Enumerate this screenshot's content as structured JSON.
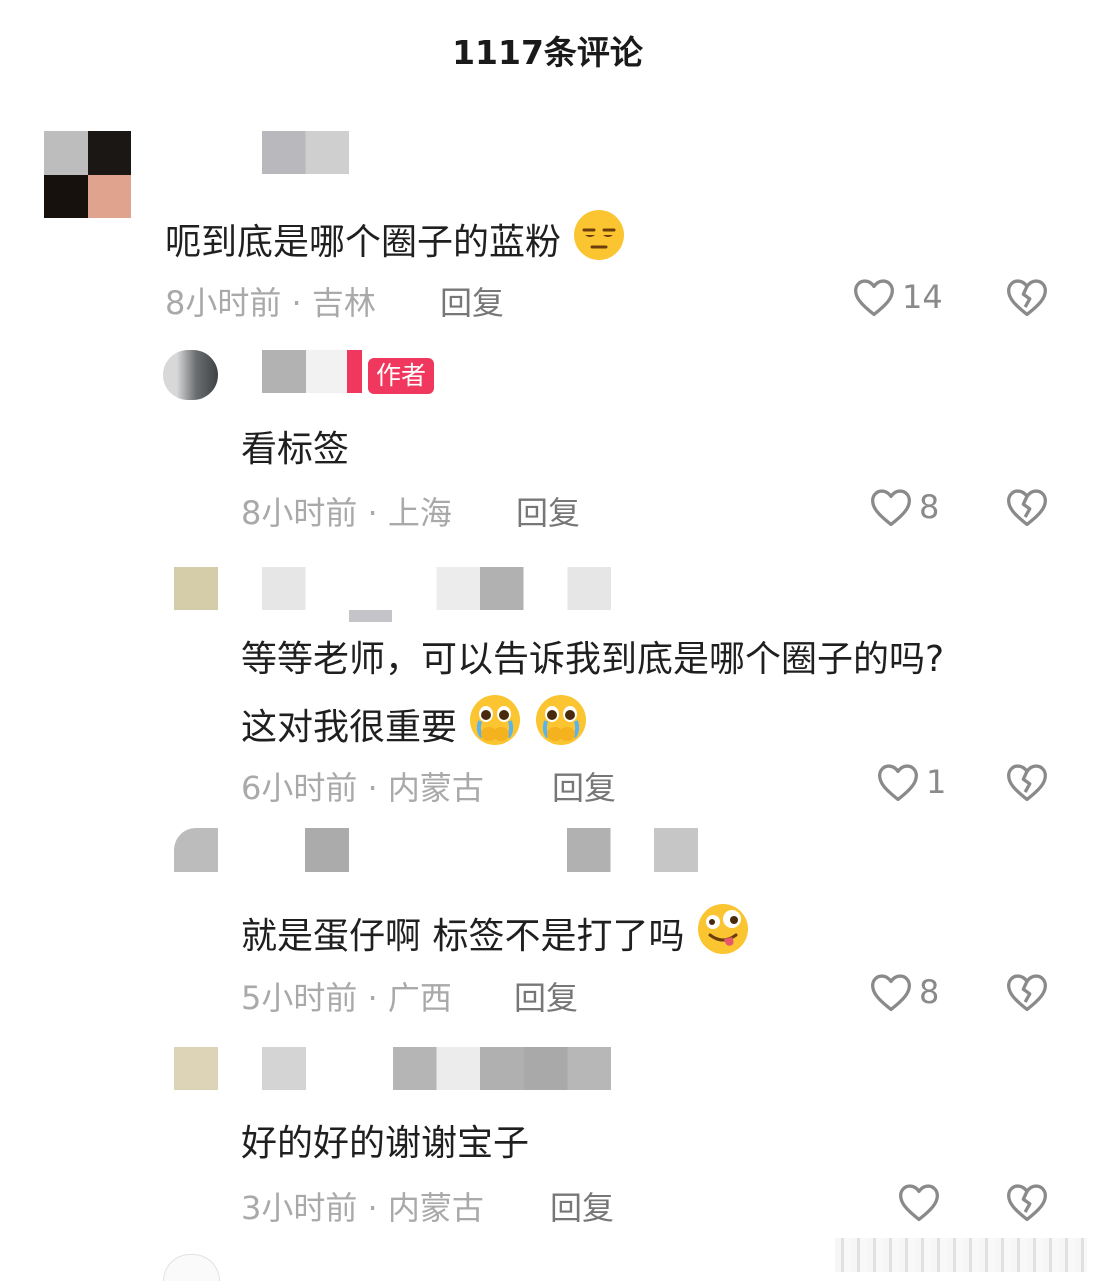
{
  "header": {
    "title": "1117条评论"
  },
  "comments": [
    {
      "text": "呃到底是哪个圈子的蓝粉",
      "time": "8小时前",
      "location": "吉林",
      "reply": "回复",
      "likes": "14"
    },
    {
      "badge": "作者",
      "text": "看标签",
      "time": "8小时前",
      "location": "上海",
      "reply": "回复",
      "likes": "8"
    },
    {
      "text_line1": "等等老师，可以告诉我到底是哪个圈子的吗?",
      "text_line2": "这对我很重要",
      "time": "6小时前",
      "location": "内蒙古",
      "reply": "回复",
      "likes": "1"
    },
    {
      "text": "就是蛋仔啊 标签不是打了吗",
      "time": "5小时前",
      "location": "广西",
      "reply": "回复",
      "likes": "8"
    },
    {
      "text": "好的好的谢谢宝子",
      "time": "3小时前",
      "location": "内蒙古",
      "reply": "回复",
      "likes": ""
    }
  ],
  "separator": "·",
  "icons": {
    "like": "heart-outline-icon",
    "dislike": "broken-heart-icon",
    "emoji_1": "unamused-face-emoji",
    "emoji_3": "pleading-face-holding-tears-emoji",
    "emoji_4": "zany-face-emoji"
  },
  "colors": {
    "badge": "#f0385e",
    "meta": "#a9a9a9",
    "text": "#1f1f1f"
  }
}
